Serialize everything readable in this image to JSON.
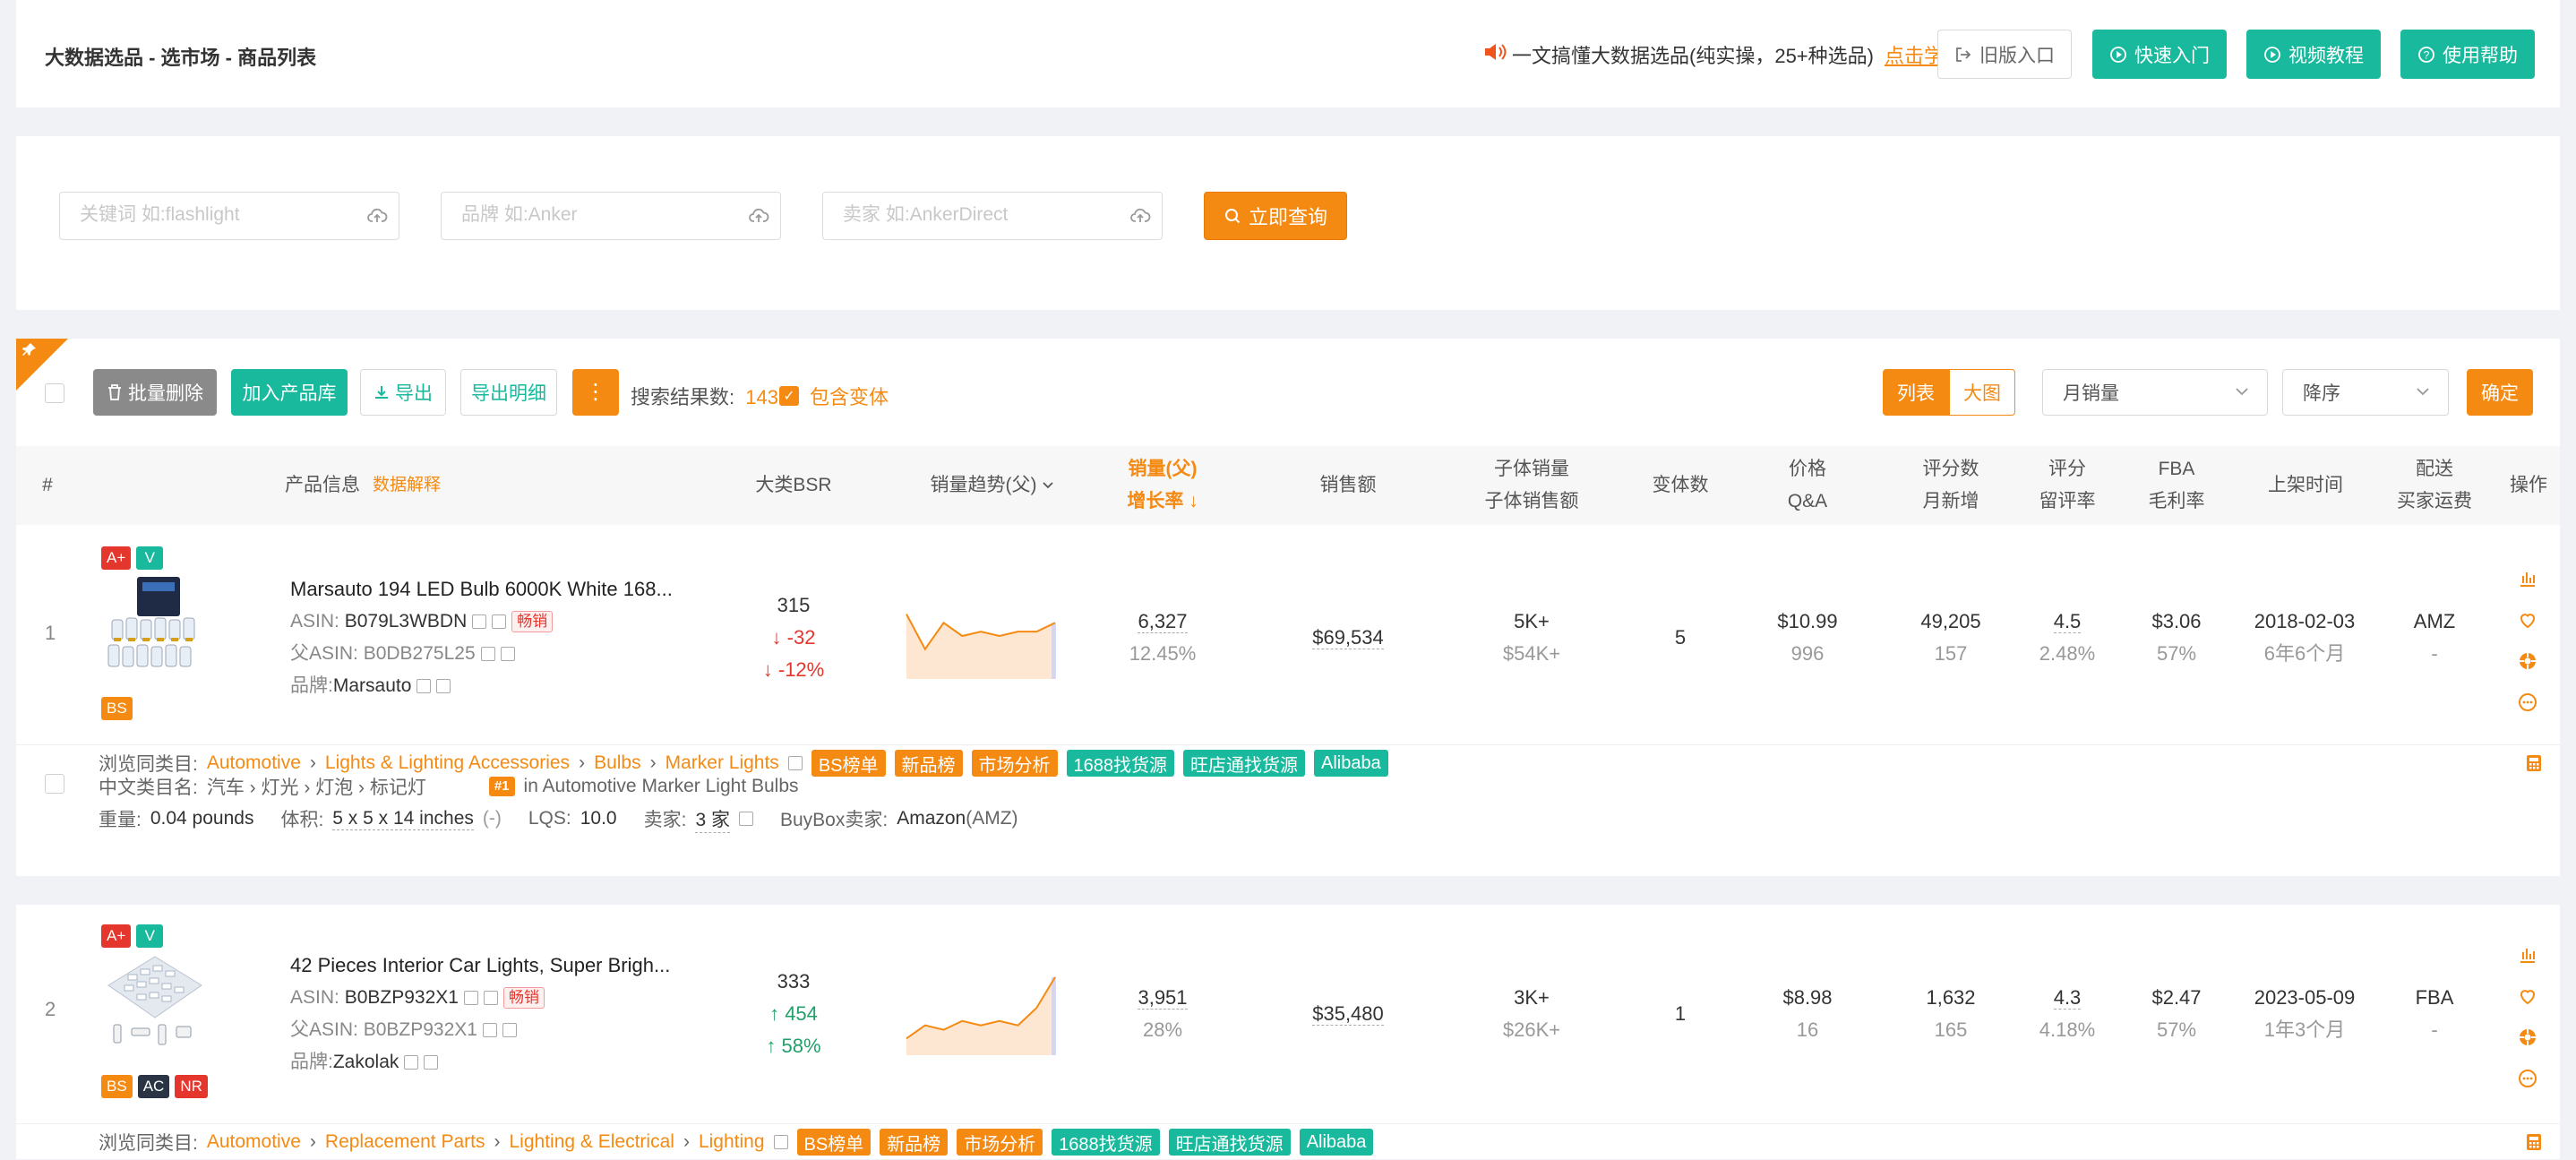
{
  "header": {
    "breadcrumb": "大数据选品 - 选市场 - 商品列表",
    "notice_text": "一文搞懂大数据选品(纯实操，25+种选品)",
    "notice_link": "点击学习",
    "old_entry": "旧版入口",
    "quick_start": "快速入门",
    "video_tutorial": "视频教程",
    "help": "使用帮助"
  },
  "search": {
    "keyword_placeholder": "关键词 如:flashlight",
    "brand_placeholder": "品牌 如:Anker",
    "seller_placeholder": "卖家 如:AnkerDirect",
    "query_button": "立即查询"
  },
  "toolbar": {
    "batch_delete": "批量删除",
    "add_library": "加入产品库",
    "export": "导出",
    "export_detail": "导出明细",
    "result_label": "搜索结果数:",
    "result_count": "143",
    "include_variants": "包含变体",
    "view_list": "列表",
    "view_grid": "大图",
    "sort_field": "月销量",
    "sort_order": "降序",
    "confirm": "确定"
  },
  "columns": {
    "index": "#",
    "product": "产品信息",
    "data_explain": "数据解释",
    "bsr": "大类BSR",
    "trend": "销量趋势(父)",
    "sales_1": "销量(父)",
    "sales_2": "增长率",
    "revenue": "销售额",
    "child_1": "子体销量",
    "child_2": "子体销售额",
    "variants": "变体数",
    "price_1": "价格",
    "price_2": "Q&A",
    "reviews_1": "评分数",
    "reviews_2": "月新增",
    "rating_1": "评分",
    "rating_2": "留评率",
    "fba_1": "FBA",
    "fba_2": "毛利率",
    "launch": "上架时间",
    "ship_1": "配送",
    "ship_2": "买家运费",
    "ops": "操作"
  },
  "products": [
    {
      "index": "1",
      "badges_top": [
        "A+",
        "V"
      ],
      "badges_bottom": [
        "BS"
      ],
      "title": "Marsauto 194 LED Bulb 6000K White 168...",
      "asin_label": "ASIN:",
      "asin": "B079L3WBDN",
      "hot": "畅销",
      "parent_label": "父ASIN:",
      "parent_asin": "B0DB275L25",
      "brand_label": "品牌:",
      "brand": "Marsauto",
      "bsr": "315",
      "bsr_change": "↓ -32",
      "bsr_pct": "↓ -12%",
      "trend_points": [
        14,
        6,
        12,
        9,
        10,
        9,
        10,
        10,
        12
      ],
      "sales": "6,327",
      "growth": "12.45%",
      "revenue": "$69,534",
      "child_sales": "5K+",
      "child_revenue": "$54K+",
      "variants": "5",
      "price": "$10.99",
      "qa": "996",
      "reviews": "49,205",
      "reviews_new": "157",
      "rating": "4.5",
      "review_rate": "2.48%",
      "fba": "$3.06",
      "margin": "57%",
      "launch": "2018-02-03",
      "age": "6年6个月",
      "ship": "AMZ",
      "ship_fee": "-",
      "category_label": "浏览同类目:",
      "categories": [
        "Automotive",
        "Lights & Lighting Accessories",
        "Bulbs",
        "Marker Lights"
      ],
      "cn_label": "中文类目名:",
      "cn_category": "汽车 › 灯光 › 灯泡 › 标记灯",
      "rank_badge": "#1",
      "rank_text": "in Automotive Marker Light Bulbs",
      "weight_label": "重量:",
      "weight": "0.04 pounds",
      "volume_label": "体积:",
      "volume": "5 x 5 x 14 inches",
      "volume_note": "(-)",
      "lqs_label": "LQS:",
      "lqs": "10.0",
      "seller_label": "卖家:",
      "seller": "3 家",
      "buybox_label": "BuyBox卖家:",
      "buybox": "Amazon",
      "buybox_note": "(AMZ)"
    },
    {
      "index": "2",
      "badges_top": [
        "A+",
        "V"
      ],
      "badges_bottom": [
        "BS",
        "AC",
        "NR"
      ],
      "title": "42 Pieces Interior Car Lights, Super Brigh...",
      "asin_label": "ASIN:",
      "asin": "B0BZP932X1",
      "hot": "畅销",
      "parent_label": "父ASIN:",
      "parent_asin": "B0BZP932X1",
      "brand_label": "品牌:",
      "brand": "Zakolak",
      "bsr": "333",
      "bsr_change": "↑ 454",
      "bsr_pct": "↑ 58%",
      "trend_points": [
        3,
        6,
        5,
        7,
        6,
        7,
        6,
        10,
        17
      ],
      "sales": "3,951",
      "growth": "28%",
      "revenue": "$35,480",
      "child_sales": "3K+",
      "child_revenue": "$26K+",
      "variants": "1",
      "price": "$8.98",
      "qa": "16",
      "reviews": "1,632",
      "reviews_new": "165",
      "rating": "4.3",
      "review_rate": "4.18%",
      "fba": "$2.47",
      "margin": "57%",
      "launch": "2023-05-09",
      "age": "1年3个月",
      "ship": "FBA",
      "ship_fee": "-",
      "category_label": "浏览同类目:",
      "categories": [
        "Automotive",
        "Replacement Parts",
        "Lighting & Electrical",
        "Lighting"
      ]
    }
  ],
  "tags": [
    "BS榜单",
    "新品榜",
    "市场分析",
    "1688找货源",
    "旺店通找货源",
    "Alibaba"
  ],
  "colors": {
    "accent": "#f58a12",
    "teal": "#19b99d",
    "red": "#e5362d",
    "green": "#22a06b"
  }
}
